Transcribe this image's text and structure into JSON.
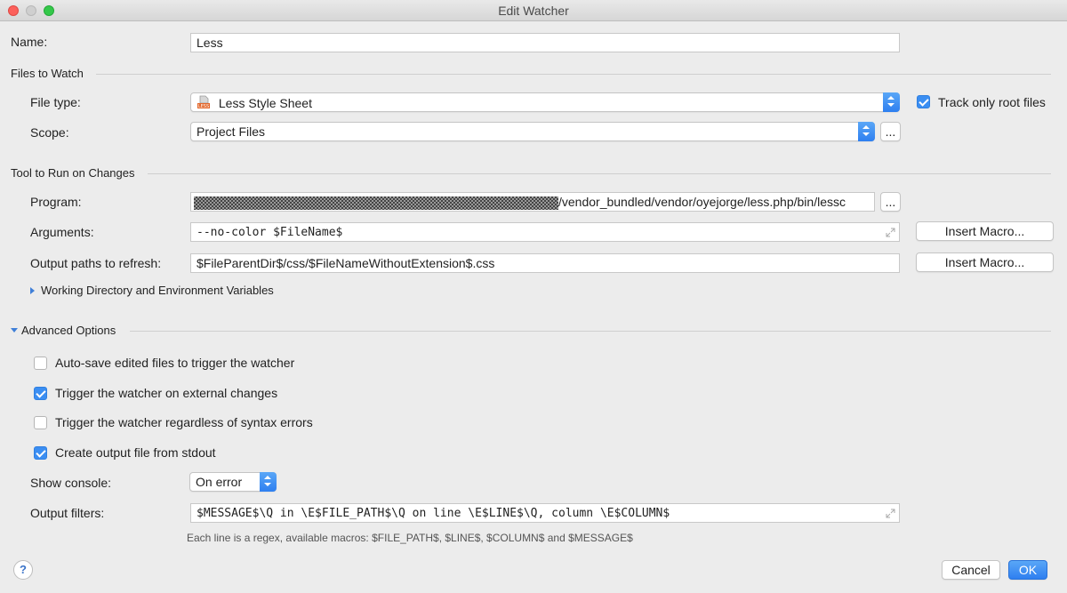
{
  "window": {
    "title": "Edit Watcher"
  },
  "name": {
    "label": "Name:",
    "value": "Less"
  },
  "files_to_watch": {
    "title": "Files to Watch",
    "file_type_label": "File type:",
    "file_type_value": "Less Style Sheet",
    "file_type_icon": "less-file-icon",
    "track_root_label": "Track only root files",
    "track_root_checked": true,
    "scope_label": "Scope:",
    "scope_value": "Project Files",
    "scope_browse": "..."
  },
  "tool": {
    "title": "Tool to Run on Changes",
    "program_label": "Program:",
    "program_value_suffix": "/vendor_bundled/vendor/oyejorge/less.php/bin/lessc",
    "program_browse": "...",
    "arguments_label": "Arguments:",
    "arguments_value": "--no-color $FileName$",
    "arguments_macro": "Insert Macro...",
    "output_label": "Output paths to refresh:",
    "output_value": "$FileParentDir$/css/$FileNameWithoutExtension$.css",
    "output_macro": "Insert Macro...",
    "workdir_label": "Working Directory and Environment Variables"
  },
  "advanced": {
    "title": "Advanced Options",
    "options": [
      {
        "label": "Auto-save edited files to trigger the watcher",
        "checked": false
      },
      {
        "label": "Trigger the watcher on external changes",
        "checked": true
      },
      {
        "label": "Trigger the watcher regardless of syntax errors",
        "checked": false
      },
      {
        "label": "Create output file from stdout",
        "checked": true
      }
    ],
    "console_label": "Show console:",
    "console_value": "On error",
    "filters_label": "Output filters:",
    "filters_value": "$MESSAGE$\\Q in \\E$FILE_PATH$\\Q on line \\E$LINE$\\Q, column \\E$COLUMN$",
    "hint": "Each line is a regex, available macros: $FILE_PATH$, $LINE$, $COLUMN$ and $MESSAGE$"
  },
  "footer": {
    "help": "?",
    "cancel": "Cancel",
    "ok": "OK"
  },
  "colors": {
    "accent": "#3b8ef2",
    "background": "#ececec"
  }
}
